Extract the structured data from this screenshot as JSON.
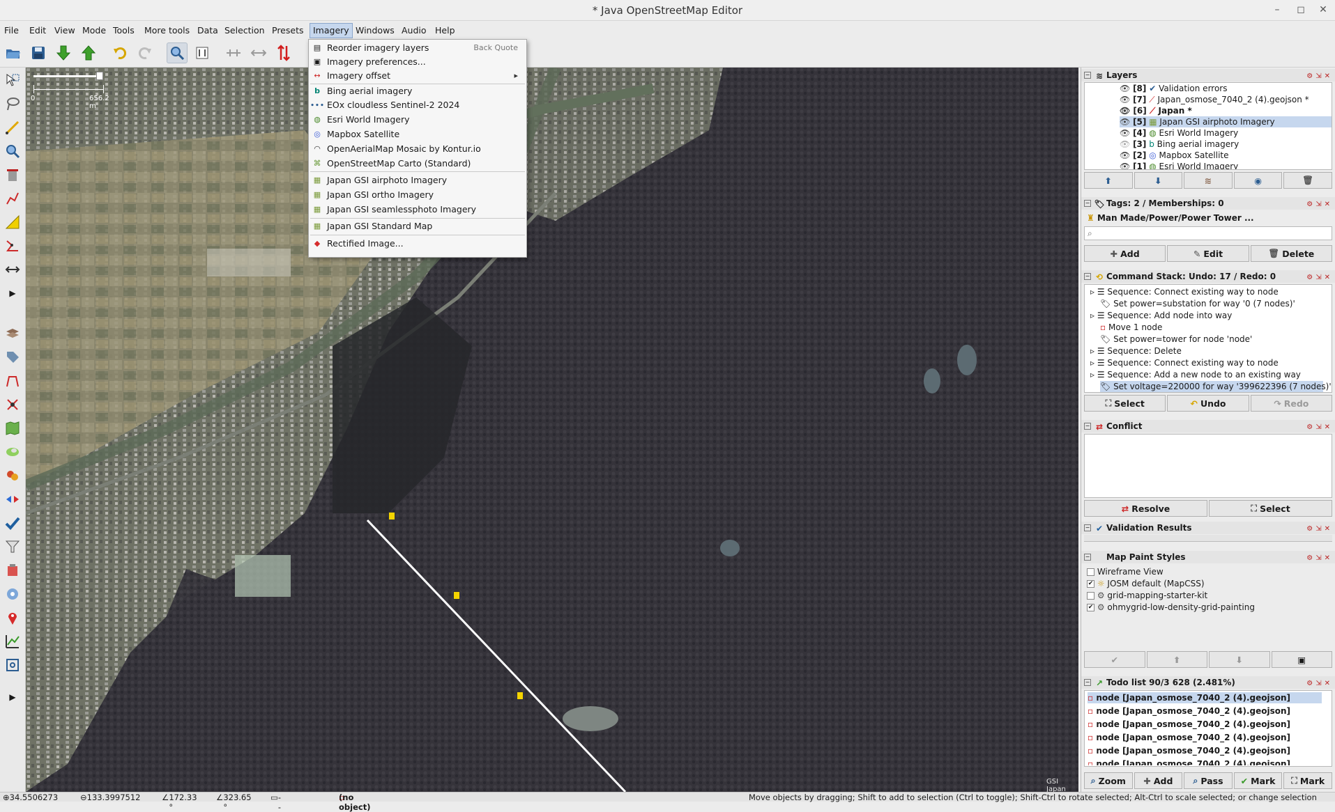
{
  "window": {
    "title": "* Java OpenStreetMap Editor"
  },
  "menubar": [
    "File",
    "Edit",
    "View",
    "Mode",
    "Tools",
    "More tools",
    "Data",
    "Selection",
    "Presets",
    "Imagery",
    "Windows",
    "Audio",
    "Help"
  ],
  "imagery_menu": {
    "reorder": "Reorder imagery layers",
    "reorder_shortcut": "Back Quote",
    "preferences": "Imagery preferences...",
    "offset": "Imagery offset",
    "bing": "Bing aerial imagery",
    "eox": "EOx cloudless Sentinel-2 2024",
    "esri": "Esri World Imagery",
    "mapbox": "Mapbox Satellite",
    "oam": "OpenAerialMap Mosaic by Kontur.io",
    "osm_carto": "OpenStreetMap Carto (Standard)",
    "gsi_airphoto": "Japan GSI airphoto Imagery",
    "gsi_ortho": "Japan GSI ortho Imagery",
    "gsi_seamless": "Japan GSI seamlessphoto Imagery",
    "gsi_standard": "Japan GSI Standard Map",
    "rectified": "Rectified Image..."
  },
  "map": {
    "scale_start": "0",
    "scale_end": "656.2 m",
    "attribution": "GSI Japan"
  },
  "layers": {
    "title": "Layers",
    "items": [
      {
        "idx": "[8]",
        "name": "Validation errors"
      },
      {
        "idx": "[7]",
        "name": "Japan_osmose_7040_2 (4).geojson *"
      },
      {
        "idx": "[6]",
        "name": "Japan *"
      },
      {
        "idx": "[5]",
        "name": "Japan GSI airphoto Imagery"
      },
      {
        "idx": "[4]",
        "name": "Esri World Imagery"
      },
      {
        "idx": "[3]",
        "name": "Bing aerial imagery"
      },
      {
        "idx": "[2]",
        "name": "Mapbox Satellite"
      },
      {
        "idx": "[1]",
        "name": "Esri World Imagery"
      }
    ]
  },
  "tags": {
    "title": "Tags: 2 / Memberships: 0",
    "preset": "Man Made/Power/Power Tower ...",
    "buttons": [
      "Add",
      "Edit",
      "Delete"
    ]
  },
  "command_stack": {
    "title": "Command Stack: Undo: 17 / Redo: 0",
    "items": [
      "Sequence: Connect existing way to node",
      "Set power=substation for way '0 (7 nodes)'",
      "Sequence: Add node into way",
      "Move 1 node",
      "Set power=tower for node 'node'",
      "Sequence: Delete",
      "Sequence: Connect existing way to node",
      "Sequence: Add a new node to an existing way",
      "Set voltage=220000 for way '399622396 (7 nodes)'"
    ],
    "buttons": [
      "Select",
      "Undo",
      "Redo"
    ]
  },
  "conflict": {
    "title": "Conflict",
    "buttons": [
      "Resolve",
      "Select"
    ]
  },
  "validation": {
    "title": "Validation Results"
  },
  "map_paint": {
    "title": "Map Paint Styles",
    "items": [
      {
        "name": "Wireframe View",
        "checked": false
      },
      {
        "name": "JOSM default (MapCSS)",
        "checked": true
      },
      {
        "name": "grid-mapping-starter-kit",
        "checked": false
      },
      {
        "name": "ohmygrid-low-density-grid-painting",
        "checked": true
      }
    ]
  },
  "todo": {
    "title": "Todo list 90/3 628 (2.481%)",
    "items": [
      "node [Japan_osmose_7040_2 (4).geojson]",
      "node [Japan_osmose_7040_2 (4).geojson]",
      "node [Japan_osmose_7040_2 (4).geojson]",
      "node [Japan_osmose_7040_2 (4).geojson]",
      "node [Japan_osmose_7040_2 (4).geojson]",
      "node [Japan_osmose_7040_2 (4).geojson]"
    ],
    "buttons": [
      "Zoom",
      "Add",
      "Pass",
      "Mark",
      "Mark"
    ]
  },
  "status": {
    "lat": "34.5506273",
    "lon": "133.3997512",
    "heading": "172.33 °",
    "angle": "323.65 °",
    "dist": "--",
    "name": "(no object)",
    "help": "Move objects by dragging; Shift to add to selection (Ctrl to toggle); Shift-Ctrl to rotate selected; Alt-Ctrl to scale selected; or change selection"
  },
  "colors": {
    "accent": "#c6d7ee",
    "power_line": "#ffffff",
    "tower": "#f5d400"
  }
}
